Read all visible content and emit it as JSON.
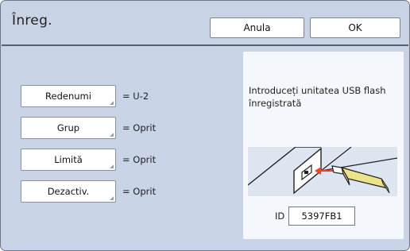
{
  "header": {
    "title": "Înreg.",
    "cancel_label": "Anula",
    "ok_label": "OK"
  },
  "settings": [
    {
      "label": "Redenumi",
      "value": "= U-2"
    },
    {
      "label": "Grup",
      "value": "= Oprit"
    },
    {
      "label": "Limită",
      "value": "= Oprit"
    },
    {
      "label": "Dezactiv.",
      "value": "= Oprit"
    }
  ],
  "usb_panel": {
    "instruction": "Introduceți unitatea USB flash înregistrată",
    "id_label": "ID",
    "id_value": "5397FB1",
    "illustration": "usb-insert-illustration",
    "arrow_color": "#e8452c",
    "usb_color": "#e9e48a"
  },
  "colors": {
    "background": "#c8d4e6",
    "panel": "#f4f7fb"
  }
}
